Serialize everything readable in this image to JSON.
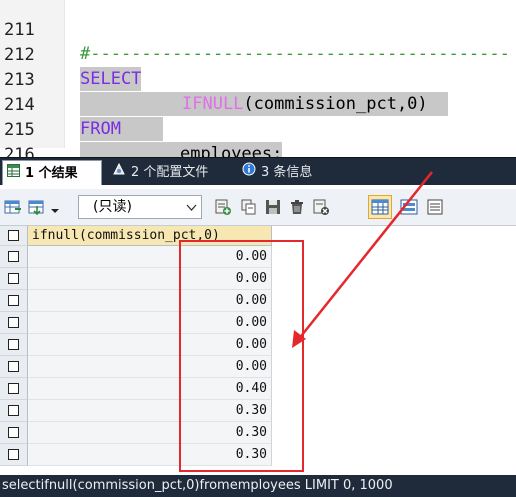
{
  "editor": {
    "lines": [
      {
        "num": "211",
        "text": "#-----------------------------------------"
      },
      {
        "num": "212",
        "keyword": "SELECT"
      },
      {
        "num": "213",
        "fn": "IFNULL",
        "args": "(commission_pct,0)"
      },
      {
        "num": "214",
        "keyword": "FROM"
      },
      {
        "num": "215",
        "text": "employees;"
      },
      {
        "num": "216",
        "text": ""
      }
    ]
  },
  "tabs": [
    {
      "label": "1 个结果",
      "icon": "result-grid-icon",
      "active": true
    },
    {
      "label": "2 个配置文件",
      "icon": "profile-icon",
      "active": false
    },
    {
      "label": "3 条信息",
      "icon": "info-icon",
      "active": false
    }
  ],
  "toolbar": {
    "mode_value": "(只读)"
  },
  "grid": {
    "column_header": "ifnull(commission_pct,0)",
    "rows": [
      "0.00",
      "0.00",
      "0.00",
      "0.00",
      "0.00",
      "0.00",
      "0.40",
      "0.30",
      "0.30",
      "0.30"
    ]
  },
  "status": {
    "text": "selectifnull(commission_pct,0)fromemployees LIMIT 0, 1000"
  },
  "colors": {
    "annotation_red": "#e4282d",
    "keyword": "#7a2ee0",
    "function": "#e070e8"
  }
}
